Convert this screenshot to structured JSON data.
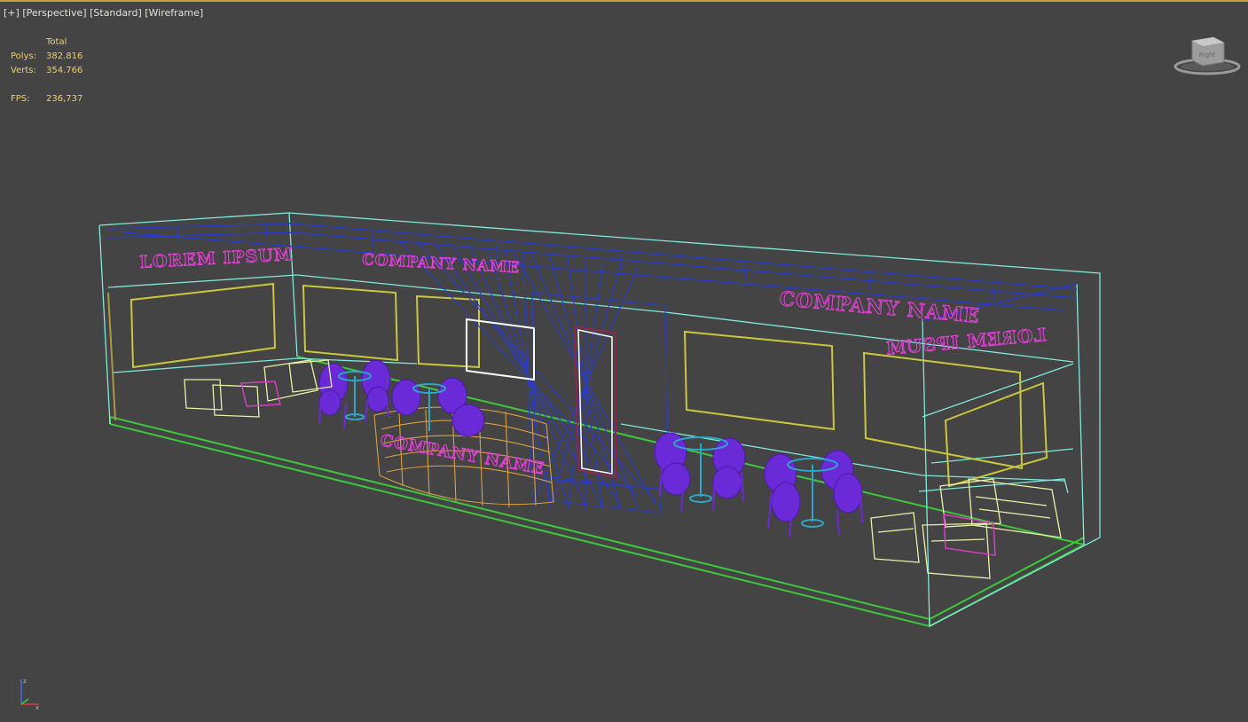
{
  "viewport": {
    "plus_label": "[+]",
    "view_label": "[Perspective]",
    "shading_label": "[Standard]",
    "mode_label": "[Wireframe]"
  },
  "stats": {
    "header": "Total",
    "polys_label": "Polys:",
    "polys_value": "382.816",
    "verts_label": "Verts:",
    "verts_value": "354.766",
    "fps_label": "FPS:",
    "fps_value": "236,737"
  },
  "signage": {
    "left_wall_text": "LOREM IPSUM",
    "back_wall_text": "COMPANY NAME",
    "right_back_text": "COMPANY NAME",
    "right_side_text": "LOREM IPSUM",
    "counter_text": "COMPANY NAME"
  },
  "viewcube": {
    "face_label": "Right"
  },
  "colors": {
    "background": "#444444",
    "stats_text": "#f0d060",
    "wire_cyan": "#7fe8d8",
    "wire_blue": "#2a3cc8",
    "wire_green": "#3cc83c",
    "wire_yellow": "#c8c83c",
    "furniture_purple": "#6a2ad8",
    "furniture_cream": "#e8f0a8",
    "neon_pink": "#e23fd4",
    "counter_orange": "#d8a040"
  }
}
